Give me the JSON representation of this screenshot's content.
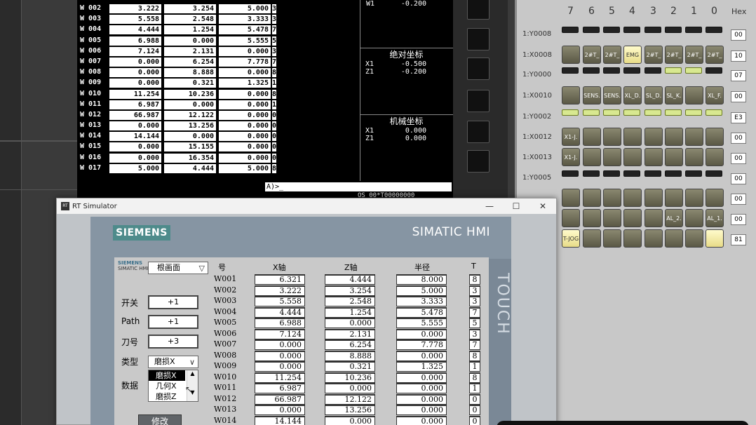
{
  "cnc": {
    "rows": [
      {
        "id": "W 002",
        "x": "3.222",
        "z": "3.254",
        "r": "5.000",
        "t": "3"
      },
      {
        "id": "W 003",
        "x": "5.558",
        "z": "2.548",
        "r": "3.333",
        "t": "3"
      },
      {
        "id": "W 004",
        "x": "4.444",
        "z": "1.254",
        "r": "5.478",
        "t": "7"
      },
      {
        "id": "W 005",
        "x": "6.988",
        "z": "0.000",
        "r": "5.555",
        "t": "5"
      },
      {
        "id": "W 006",
        "x": "7.124",
        "z": "2.131",
        "r": "0.000",
        "t": "3"
      },
      {
        "id": "W 007",
        "x": "0.000",
        "z": "6.254",
        "r": "7.778",
        "t": "7"
      },
      {
        "id": "W 008",
        "x": "0.000",
        "z": "8.888",
        "r": "0.000",
        "t": "8"
      },
      {
        "id": "W 009",
        "x": "0.000",
        "z": "0.321",
        "r": "1.325",
        "t": "1"
      },
      {
        "id": "W 010",
        "x": "11.254",
        "z": "10.236",
        "r": "0.000",
        "t": "8"
      },
      {
        "id": "W 011",
        "x": "6.987",
        "z": "0.000",
        "r": "0.000",
        "t": "1"
      },
      {
        "id": "W 012",
        "x": "66.987",
        "z": "12.122",
        "r": "0.000",
        "t": "0"
      },
      {
        "id": "W 013",
        "x": "0.000",
        "z": "13.256",
        "r": "0.000",
        "t": "0"
      },
      {
        "id": "W 014",
        "x": "14.144",
        "z": "0.000",
        "r": "0.000",
        "t": "0"
      },
      {
        "id": "W 015",
        "x": "0.000",
        "z": "15.155",
        "r": "0.000",
        "t": "0"
      },
      {
        "id": "W 016",
        "x": "0.000",
        "z": "16.354",
        "r": "0.000",
        "t": "0"
      },
      {
        "id": "W 017",
        "x": "5.000",
        "z": "4.444",
        "r": "5.000",
        "t": "8"
      }
    ],
    "w1_label": "W1",
    "w1_value": "-0.200",
    "abs_title": "绝对坐标",
    "abs_x_label": "X1",
    "abs_x": "-0.500",
    "abs_z_label": "Z1",
    "abs_z": "-0.200",
    "mach_title": "机械坐标",
    "mach_x_label": "X1",
    "mach_x": "0.000",
    "mach_z_label": "Z1",
    "mach_z": "0.000",
    "command": "A)>_",
    "status": "OS  00*T00000000"
  },
  "io": {
    "bits": [
      "7",
      "6",
      "5",
      "4",
      "3",
      "2",
      "1",
      "0"
    ],
    "hex_label": "Hex",
    "rows": [
      {
        "label": "1:Y0008",
        "kind": "led",
        "on": [],
        "hex": "00"
      },
      {
        "label": "1:X0008",
        "kind": "btn",
        "btns": [
          "",
          "2#T_",
          "2#T_",
          "EMG",
          "2#T_",
          "2#T_",
          "2#T_",
          "2#T_"
        ],
        "lit": [
          3
        ],
        "hex": "10"
      },
      {
        "label": "1:Y0000",
        "kind": "led",
        "on": [
          5,
          6
        ],
        "hex": "07"
      },
      {
        "label": "1:X0010",
        "kind": "btn",
        "btns": [
          "",
          "SENS.",
          "SENS.",
          "XL_D.",
          "SL_D.",
          "SL_K.",
          "",
          "XL_F."
        ],
        "lit": [],
        "hex": "00"
      },
      {
        "label": "1:Y0002",
        "kind": "led",
        "on": [
          0,
          1,
          2,
          3,
          4,
          5,
          6,
          7
        ],
        "hex": "E3"
      },
      {
        "label": "1:X0012",
        "kind": "btn",
        "btns": [
          "X1-J.",
          "",
          "",
          "",
          "",
          "",
          "",
          ""
        ],
        "lit": [],
        "hex": "00"
      },
      {
        "label": "1:X0013",
        "kind": "btn",
        "btns": [
          "X1-J.",
          "",
          "",
          "",
          "",
          "",
          "",
          ""
        ],
        "lit": [],
        "hex": "00"
      },
      {
        "label": "1:Y0005",
        "kind": "led",
        "on": [],
        "hex": "00"
      },
      {
        "label": "",
        "kind": "btn",
        "btns": [
          "",
          "",
          "",
          "",
          "",
          "",
          "",
          ""
        ],
        "lit": [],
        "hex": "00"
      },
      {
        "label": "",
        "kind": "btn",
        "btns": [
          "",
          "",
          "",
          "",
          "",
          "AL_2.",
          "",
          "AL_1."
        ],
        "lit": [],
        "hex": "00"
      },
      {
        "label": "",
        "kind": "btn",
        "btns": [
          "T-JOG",
          "",
          "",
          "",
          "",
          "",
          "",
          ""
        ],
        "lit": [
          0,
          7
        ],
        "hex": "81"
      }
    ]
  },
  "window": {
    "title": "RT Simulator",
    "minimize": "—",
    "maximize": "☐",
    "close": "✕"
  },
  "hmi": {
    "brand": "SIEMENS",
    "product": "SIMATIC HMI",
    "touch": "TOUCH",
    "logo_top": "SIEMENS",
    "logo_bottom": "SIMATIC HMI",
    "screen_select": "根画面",
    "col_no": "号",
    "col_x": "X轴",
    "col_z": "Z轴",
    "col_r": "半径",
    "col_t": "T",
    "label_switch": "开关",
    "value_switch": "+1",
    "label_path": "Path",
    "value_path": "+1",
    "label_tool": "刀号",
    "value_tool": "+3",
    "label_type": "类型",
    "value_type": "磨损X",
    "label_data": "数据",
    "dropdown_options": [
      "磨损X",
      "几何X",
      "磨损Z"
    ],
    "modify_button": "修改",
    "rows": [
      {
        "id": "W001",
        "x": "6.321",
        "z": "4.444",
        "r": "8.000",
        "t": "8"
      },
      {
        "id": "W002",
        "x": "3.222",
        "z": "3.254",
        "r": "5.000",
        "t": "3"
      },
      {
        "id": "W003",
        "x": "5.558",
        "z": "2.548",
        "r": "3.333",
        "t": "3"
      },
      {
        "id": "W004",
        "x": "4.444",
        "z": "1.254",
        "r": "5.478",
        "t": "7"
      },
      {
        "id": "W005",
        "x": "6.988",
        "z": "0.000",
        "r": "5.555",
        "t": "5"
      },
      {
        "id": "W006",
        "x": "7.124",
        "z": "2.131",
        "r": "0.000",
        "t": "3"
      },
      {
        "id": "W007",
        "x": "0.000",
        "z": "6.254",
        "r": "7.778",
        "t": "7"
      },
      {
        "id": "W008",
        "x": "0.000",
        "z": "8.888",
        "r": "0.000",
        "t": "8"
      },
      {
        "id": "W009",
        "x": "0.000",
        "z": "0.321",
        "r": "1.325",
        "t": "1"
      },
      {
        "id": "W010",
        "x": "11.254",
        "z": "10.236",
        "r": "0.000",
        "t": "8"
      },
      {
        "id": "W011",
        "x": "6.987",
        "z": "0.000",
        "r": "0.000",
        "t": "1"
      },
      {
        "id": "W012",
        "x": "66.987",
        "z": "12.122",
        "r": "0.000",
        "t": "0"
      },
      {
        "id": "W013",
        "x": "0.000",
        "z": "13.256",
        "r": "0.000",
        "t": "0"
      },
      {
        "id": "W014",
        "x": "14.144",
        "z": "0.000",
        "r": "0.000",
        "t": "0"
      }
    ]
  }
}
